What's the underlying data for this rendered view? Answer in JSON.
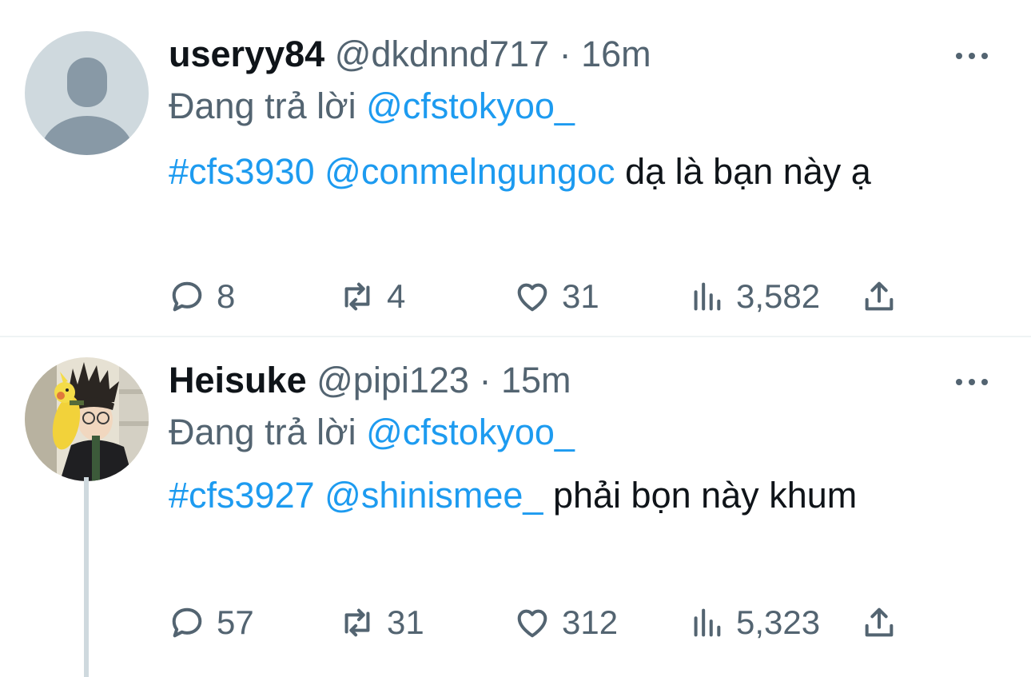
{
  "tweets": [
    {
      "display_name": "useryy84",
      "handle": "@dkdnnd717",
      "separator": "·",
      "time": "16m",
      "reply_prefix": "Đang trả lời",
      "reply_to": "@cfstokyoo_",
      "hashtag": "#cfs3930",
      "mention": "@conmelngungoc",
      "text": "dạ là bạn này ạ",
      "replies": "8",
      "retweets": "4",
      "likes": "31",
      "views": "3,582",
      "avatar": "default-avatar"
    },
    {
      "display_name": "Heisuke",
      "handle": "@pipi123",
      "separator": "·",
      "time": "15m",
      "reply_prefix": "Đang trả lời",
      "reply_to": "@cfstokyoo_",
      "hashtag": "#cfs3927",
      "mention": "@shinismee_",
      "text": "phải bọn này khum",
      "replies": "57",
      "retweets": "31",
      "likes": "312",
      "views": "5,323",
      "avatar": "anime-character-avatar"
    }
  ],
  "colors": {
    "link": "#1d9bf0",
    "muted": "#536471",
    "text": "#0f1419",
    "divider": "#eff3f4",
    "thread_line": "#cfd9de"
  },
  "icons": [
    "reply-icon",
    "retweet-icon",
    "like-icon",
    "views-icon",
    "share-icon",
    "more-icon"
  ]
}
